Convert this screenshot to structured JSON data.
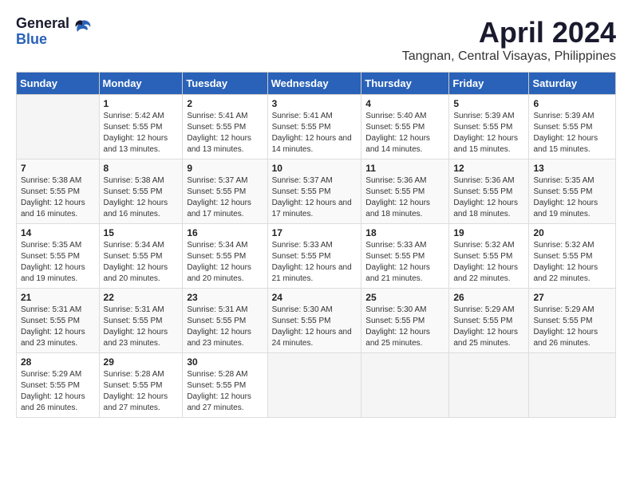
{
  "logo": {
    "general": "General",
    "blue": "Blue"
  },
  "title": "April 2024",
  "location": "Tangnan, Central Visayas, Philippines",
  "days_header": [
    "Sunday",
    "Monday",
    "Tuesday",
    "Wednesday",
    "Thursday",
    "Friday",
    "Saturday"
  ],
  "weeks": [
    [
      {
        "day": "",
        "sunrise": "",
        "sunset": "",
        "daylight": ""
      },
      {
        "day": "1",
        "sunrise": "5:42 AM",
        "sunset": "5:55 PM",
        "daylight": "12 hours and 13 minutes."
      },
      {
        "day": "2",
        "sunrise": "5:41 AM",
        "sunset": "5:55 PM",
        "daylight": "12 hours and 13 minutes."
      },
      {
        "day": "3",
        "sunrise": "5:41 AM",
        "sunset": "5:55 PM",
        "daylight": "12 hours and 14 minutes."
      },
      {
        "day": "4",
        "sunrise": "5:40 AM",
        "sunset": "5:55 PM",
        "daylight": "12 hours and 14 minutes."
      },
      {
        "day": "5",
        "sunrise": "5:39 AM",
        "sunset": "5:55 PM",
        "daylight": "12 hours and 15 minutes."
      },
      {
        "day": "6",
        "sunrise": "5:39 AM",
        "sunset": "5:55 PM",
        "daylight": "12 hours and 15 minutes."
      }
    ],
    [
      {
        "day": "7",
        "sunrise": "5:38 AM",
        "sunset": "5:55 PM",
        "daylight": "12 hours and 16 minutes."
      },
      {
        "day": "8",
        "sunrise": "5:38 AM",
        "sunset": "5:55 PM",
        "daylight": "12 hours and 16 minutes."
      },
      {
        "day": "9",
        "sunrise": "5:37 AM",
        "sunset": "5:55 PM",
        "daylight": "12 hours and 17 minutes."
      },
      {
        "day": "10",
        "sunrise": "5:37 AM",
        "sunset": "5:55 PM",
        "daylight": "12 hours and 17 minutes."
      },
      {
        "day": "11",
        "sunrise": "5:36 AM",
        "sunset": "5:55 PM",
        "daylight": "12 hours and 18 minutes."
      },
      {
        "day": "12",
        "sunrise": "5:36 AM",
        "sunset": "5:55 PM",
        "daylight": "12 hours and 18 minutes."
      },
      {
        "day": "13",
        "sunrise": "5:35 AM",
        "sunset": "5:55 PM",
        "daylight": "12 hours and 19 minutes."
      }
    ],
    [
      {
        "day": "14",
        "sunrise": "5:35 AM",
        "sunset": "5:55 PM",
        "daylight": "12 hours and 19 minutes."
      },
      {
        "day": "15",
        "sunrise": "5:34 AM",
        "sunset": "5:55 PM",
        "daylight": "12 hours and 20 minutes."
      },
      {
        "day": "16",
        "sunrise": "5:34 AM",
        "sunset": "5:55 PM",
        "daylight": "12 hours and 20 minutes."
      },
      {
        "day": "17",
        "sunrise": "5:33 AM",
        "sunset": "5:55 PM",
        "daylight": "12 hours and 21 minutes."
      },
      {
        "day": "18",
        "sunrise": "5:33 AM",
        "sunset": "5:55 PM",
        "daylight": "12 hours and 21 minutes."
      },
      {
        "day": "19",
        "sunrise": "5:32 AM",
        "sunset": "5:55 PM",
        "daylight": "12 hours and 22 minutes."
      },
      {
        "day": "20",
        "sunrise": "5:32 AM",
        "sunset": "5:55 PM",
        "daylight": "12 hours and 22 minutes."
      }
    ],
    [
      {
        "day": "21",
        "sunrise": "5:31 AM",
        "sunset": "5:55 PM",
        "daylight": "12 hours and 23 minutes."
      },
      {
        "day": "22",
        "sunrise": "5:31 AM",
        "sunset": "5:55 PM",
        "daylight": "12 hours and 23 minutes."
      },
      {
        "day": "23",
        "sunrise": "5:31 AM",
        "sunset": "5:55 PM",
        "daylight": "12 hours and 23 minutes."
      },
      {
        "day": "24",
        "sunrise": "5:30 AM",
        "sunset": "5:55 PM",
        "daylight": "12 hours and 24 minutes."
      },
      {
        "day": "25",
        "sunrise": "5:30 AM",
        "sunset": "5:55 PM",
        "daylight": "12 hours and 25 minutes."
      },
      {
        "day": "26",
        "sunrise": "5:29 AM",
        "sunset": "5:55 PM",
        "daylight": "12 hours and 25 minutes."
      },
      {
        "day": "27",
        "sunrise": "5:29 AM",
        "sunset": "5:55 PM",
        "daylight": "12 hours and 26 minutes."
      }
    ],
    [
      {
        "day": "28",
        "sunrise": "5:29 AM",
        "sunset": "5:55 PM",
        "daylight": "12 hours and 26 minutes."
      },
      {
        "day": "29",
        "sunrise": "5:28 AM",
        "sunset": "5:55 PM",
        "daylight": "12 hours and 27 minutes."
      },
      {
        "day": "30",
        "sunrise": "5:28 AM",
        "sunset": "5:55 PM",
        "daylight": "12 hours and 27 minutes."
      },
      {
        "day": "",
        "sunrise": "",
        "sunset": "",
        "daylight": ""
      },
      {
        "day": "",
        "sunrise": "",
        "sunset": "",
        "daylight": ""
      },
      {
        "day": "",
        "sunrise": "",
        "sunset": "",
        "daylight": ""
      },
      {
        "day": "",
        "sunrise": "",
        "sunset": "",
        "daylight": ""
      }
    ]
  ],
  "labels": {
    "sunrise": "Sunrise:",
    "sunset": "Sunset:",
    "daylight": "Daylight:"
  }
}
